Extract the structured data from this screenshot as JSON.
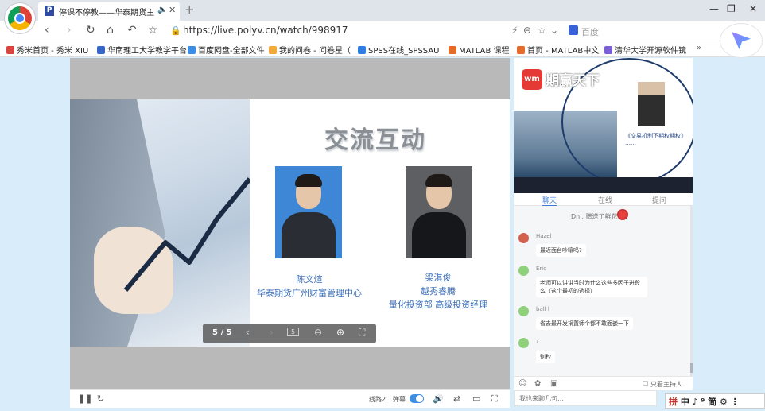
{
  "browser": {
    "tab_title": "停课不停教——华泰期货主",
    "tab_mute_icon": "speaker-mute",
    "url": "https://live.polyv.cn/watch/998917",
    "url_prefix_icon": "lock",
    "search_engine": "百度"
  },
  "bookmarks": [
    {
      "label": "秀米首页 - 秀米 XIU",
      "color": "#d8453f"
    },
    {
      "label": "华南理工大学教学平台",
      "color": "#3567c9"
    },
    {
      "label": "百度网盘-全部文件",
      "color": "#3a8ee6"
    },
    {
      "label": "我的问卷 - 问卷星（",
      "color": "#f2a93b"
    },
    {
      "label": "SPSS在线_SPSSAU",
      "color": "#2f7de1"
    },
    {
      "label": "MATLAB 课程",
      "color": "#e46b2a"
    },
    {
      "label": "首页 - MATLAB中文",
      "color": "#e46b2a"
    },
    {
      "label": "清华大学开源软件镜",
      "color": "#7b5fd3"
    }
  ],
  "slide": {
    "title": "交流互动",
    "person1": {
      "name": "陈文煊",
      "title": "华泰期货广州财富管理中心"
    },
    "person2": {
      "name": "梁淇俊",
      "title1": "越秀睿腾",
      "title2": "量化投资部 高级投资经理"
    },
    "page_indicator": "5 / 5",
    "page_box": "5"
  },
  "player": {
    "quality": "线路2",
    "barrage": "弹幕"
  },
  "side_video": {
    "logo_text": "期赢天下",
    "caption": "《交易机制下期权期权》 ……"
  },
  "side_tabs": [
    "聊天",
    "在线",
    "提问"
  ],
  "chat": {
    "gift": "Dnl. 赠送了鲜花",
    "messages": [
      {
        "user": "Hazel",
        "text": "最近面台吵嚷吗?",
        "avatar": "#d4604e"
      },
      {
        "user": "Eric",
        "text": "老师可以讲讲当时为什么这些多因子进段么（这个最初的选择）",
        "avatar": "#8fd07a"
      },
      {
        "user": "ball l",
        "text": "省去最开发捐置师个都不敢面嵌一下",
        "avatar": "#8fd07a"
      },
      {
        "user": "?",
        "text": "别秒",
        "avatar": "#8fd07a"
      }
    ],
    "only_host": "只看主持人",
    "input_placeholder": "我也来聊几句…"
  },
  "ime": "中 ♪ ⁹ 简 ⚙ ⋮"
}
